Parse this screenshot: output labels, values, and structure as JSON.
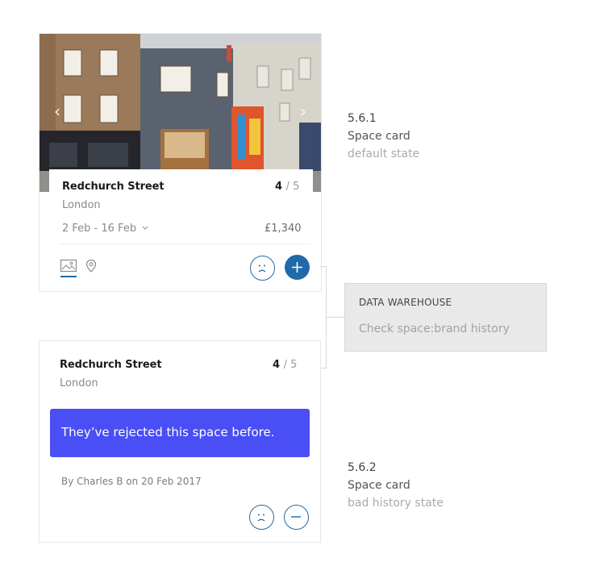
{
  "card_default": {
    "arrows": {
      "left": "‹",
      "right": "›"
    },
    "title": "Redchurch Street",
    "city": "London",
    "rating": "4",
    "rating_out_of": "/ 5",
    "dates": "2 Feb - 16 Feb",
    "price": "£1,340",
    "icons": [
      "image-icon",
      "location-pin-icon",
      "frown-face-icon",
      "plus-icon"
    ]
  },
  "card_bad_history": {
    "title": "Redchurch Street",
    "city": "London",
    "rating": "4",
    "rating_out_of": "/ 5",
    "notice": "They’ve rejected this space before.",
    "author": "By Charles B on  20 Feb 2017",
    "icons": [
      "frown-face-icon",
      "minus-icon"
    ]
  },
  "spec_1": {
    "number": "5.6.1",
    "name": "Space card",
    "state": "default state"
  },
  "spec_2": {
    "number": "5.6.2",
    "name": "Space card",
    "state": "bad history state"
  },
  "data_warehouse": {
    "title": "DATA WAREHOUSE",
    "text": "Check space:brand history"
  },
  "colors": {
    "accent_blue": "#1f6aa8",
    "notice_bg": "#4a4ef5",
    "dw_bg": "#e9e9e9"
  }
}
